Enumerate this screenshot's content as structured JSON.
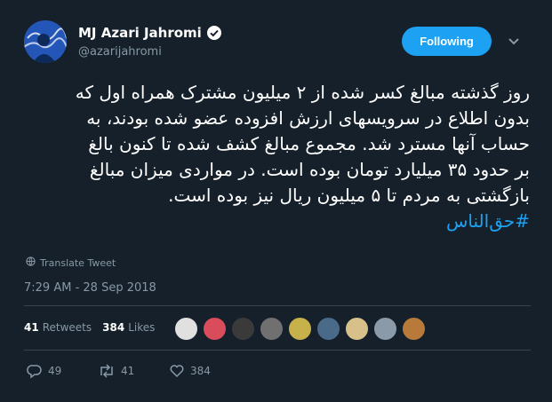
{
  "author": {
    "name": "MJ Azari Jahromi",
    "handle": "@azarijahromi"
  },
  "header": {
    "follow_label": "Following"
  },
  "tweet": {
    "lines": [
      "روز گذشته مبالغ کسر شده از ۲ میلیون مشترک همراه اول که",
      "بدون اطلاع در سرویسهای ارزش افزوده عضو شده بودند، به",
      "حساب آنها مسترد شد. مجموع مبالغ کشف شده تا کنون بالغ",
      "بر حدود ۳۵ میلیارد تومان بوده است. در مواردی میزان مبالغ",
      "بازگشتی به مردم تا ۵ میلیون ریال نیز بوده است."
    ],
    "hashtag": "#حق‌الناس",
    "translate_label": "Translate Tweet",
    "timestamp": "7:29 AM - 28 Sep 2018"
  },
  "stats": {
    "retweets_count": "41",
    "retweets_label": "Retweets",
    "likes_count": "384",
    "likes_label": "Likes"
  },
  "likers": [
    "#e0e0e0",
    "#d94c5c",
    "#3a3a3a",
    "#707070",
    "#c7b14a",
    "#4a6a8a",
    "#d8c08a",
    "#8a9aa8",
    "#b87a3a"
  ],
  "actions": {
    "replies": "49",
    "retweets": "41",
    "likes": "384"
  },
  "colors": {
    "background": "#15202b",
    "accent": "#1da1f2",
    "muted": "#8899a6"
  }
}
